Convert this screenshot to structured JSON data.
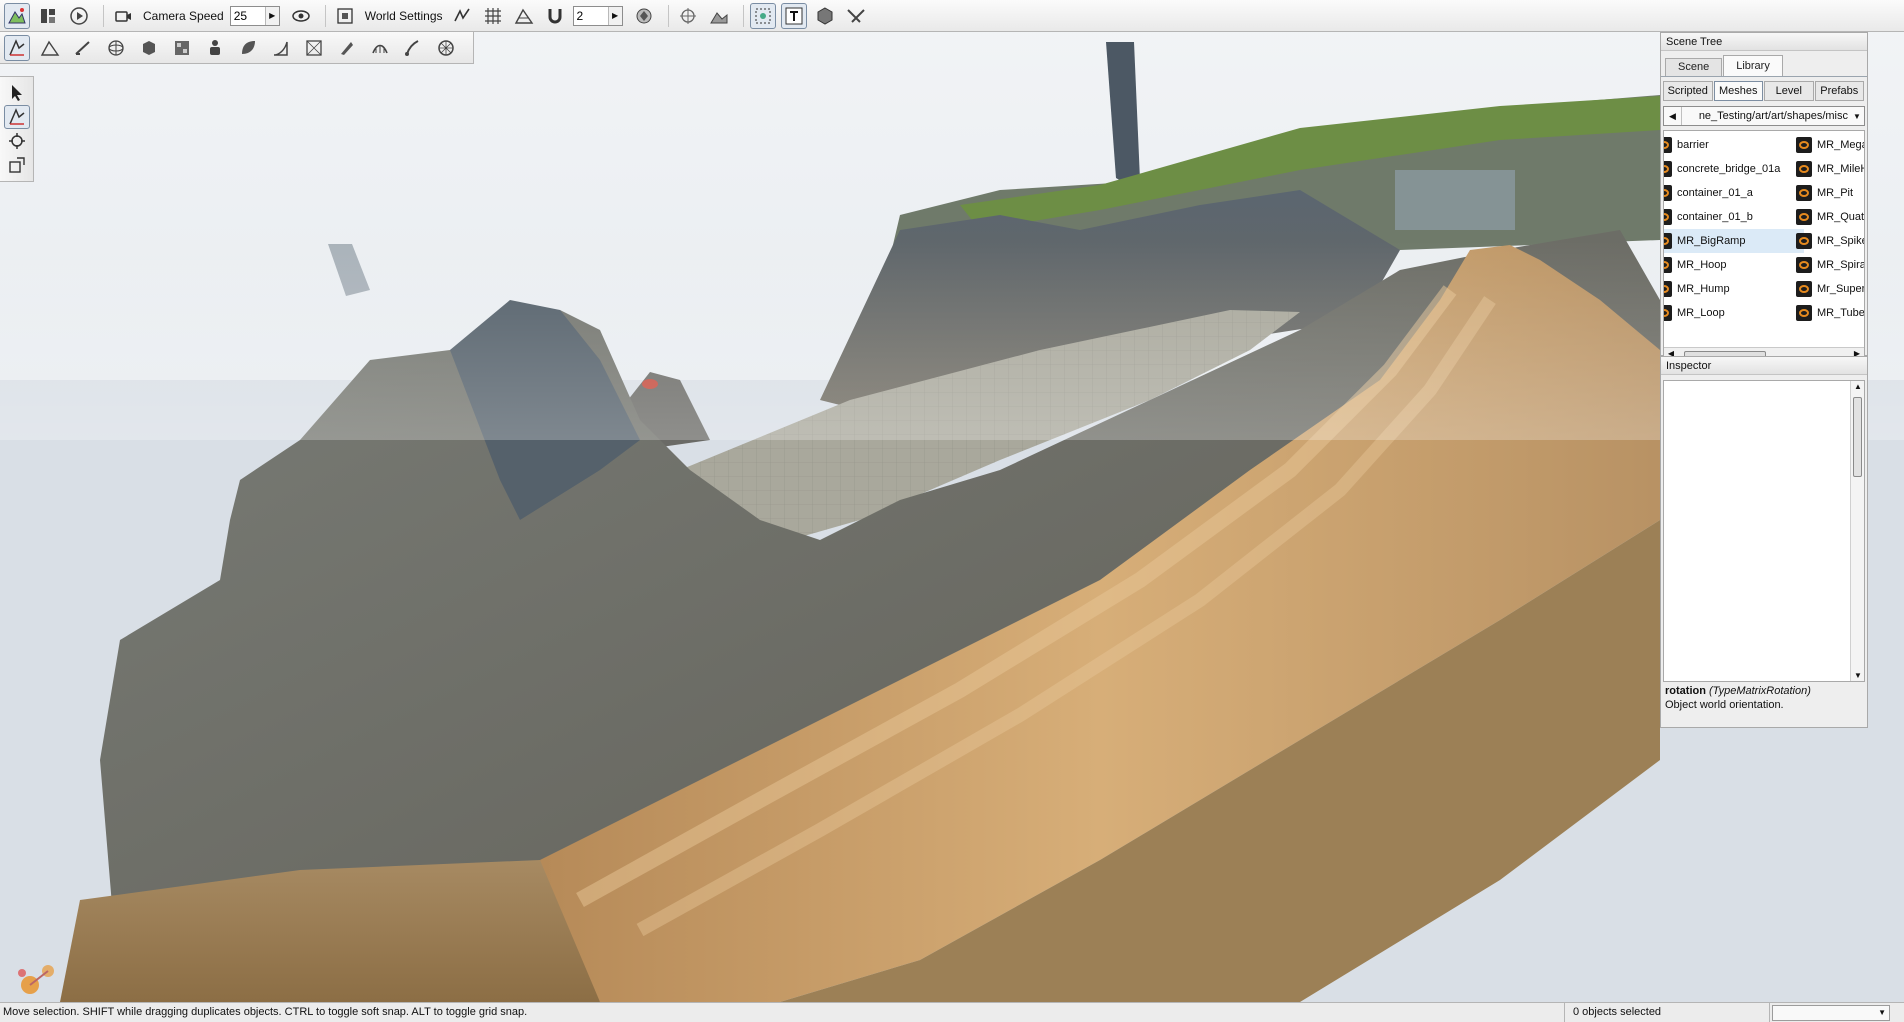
{
  "top_toolbar": {
    "camera_speed_label": "Camera Speed",
    "camera_speed_value": "25",
    "world_settings_label": "World Settings",
    "snap_value": "2"
  },
  "scene_tree": {
    "title": "Scene Tree",
    "tabs": [
      "Scene",
      "Library"
    ],
    "active_tab": "Library",
    "subtabs": [
      "Scripted",
      "Meshes",
      "Level",
      "Prefabs"
    ],
    "active_subtab": "Meshes",
    "path": "ne_Testing/art/art/shapes/misc",
    "left_items": [
      "barrier",
      "concrete_bridge_01a",
      "container_01_a",
      "container_01_b",
      "MR_BigRamp",
      "MR_Hoop",
      "MR_Hump",
      "MR_Loop"
    ],
    "right_items": [
      "MR_Mega",
      "MR_MileHi",
      "MR_Pit",
      "MR_Quate",
      "MR_Spike",
      "MR_Spiral",
      "Mr_Super",
      "MR_Tube"
    ],
    "selected_item": "MR_BigRamp"
  },
  "inspector": {
    "title": "Inspector",
    "field_name": "rotation",
    "field_type": "(TypeMatrixRotation)",
    "field_desc": "Object world orientation."
  },
  "statusbar": {
    "message": "Move selection.  SHIFT while dragging duplicates objects.  CTRL to toggle soft snap.  ALT to toggle grid snap.",
    "selection_count": "0 objects selected"
  },
  "icons": {
    "top_toolbar": [
      "terrain-editor-icon",
      "panels-icon",
      "play-icon",
      "camera-icon",
      "eye-icon",
      "fit-view-icon",
      "snap-settings-icon",
      "grid-snap-icon",
      "terrain-snap-icon",
      "magnet-icon",
      "render-icon",
      "center-icon",
      "ground-icon",
      "select-frame-icon",
      "text-icon",
      "object-icon",
      "road-icon"
    ],
    "tool_toolbar": [
      "move-tool-icon",
      "terrain-tool-icon",
      "paint-tool-icon",
      "sphere-tool-icon",
      "box-tool-icon",
      "texture-tool-icon",
      "figure-tool-icon",
      "leaf-tool-icon",
      "ramp-tool-icon",
      "bounds-tool-icon",
      "knife-tool-icon",
      "mesh-tool-icon",
      "brush-tool-icon",
      "wheel-tool-icon"
    ],
    "palette": [
      "select-arrow-icon",
      "move-gizmo-icon",
      "rotate-gizmo-icon",
      "scale-gizmo-icon"
    ]
  },
  "colors": {
    "accent": "#7d8ea2",
    "selection": "#dbeaf7",
    "mesh_icon": "#e58a1f"
  }
}
